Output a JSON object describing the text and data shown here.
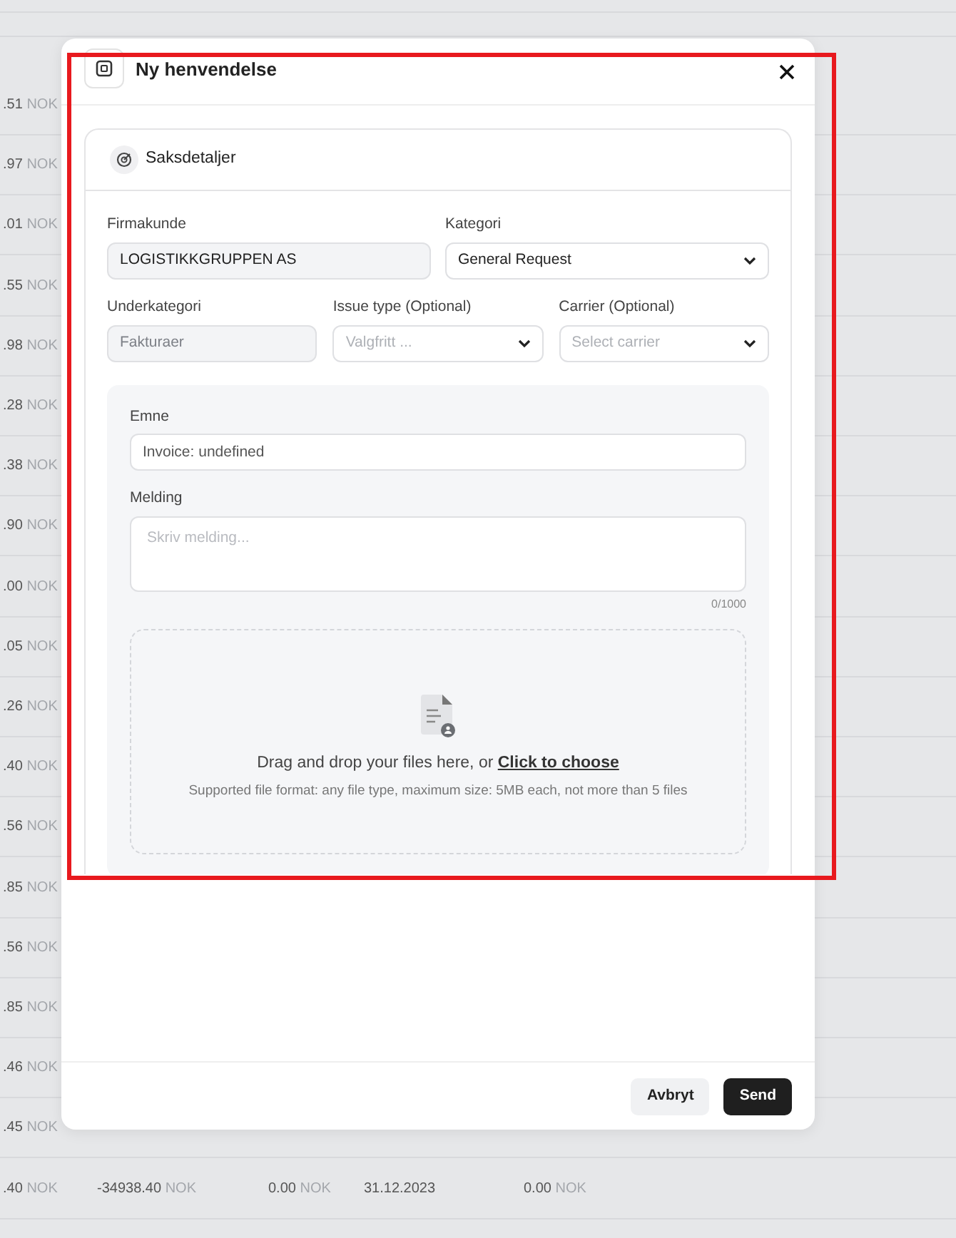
{
  "background_table": {
    "rows": [
      {
        "cells": [
          {
            "amount": ".51",
            "currency": "NOK"
          }
        ]
      },
      {
        "cells": [
          {
            "amount": ".97",
            "currency": "NOK"
          }
        ]
      },
      {
        "cells": [
          {
            "amount": ".01",
            "currency": "NOK"
          }
        ]
      },
      {
        "cells": [
          {
            "amount": ".55",
            "currency": "NOK"
          }
        ]
      },
      {
        "cells": [
          {
            "amount": ".98",
            "currency": "NOK"
          }
        ]
      },
      {
        "cells": [
          {
            "amount": ".28",
            "currency": "NOK"
          }
        ]
      },
      {
        "cells": [
          {
            "amount": ".38",
            "currency": "NOK"
          }
        ]
      },
      {
        "cells": [
          {
            "amount": ".90",
            "currency": "NOK"
          }
        ]
      },
      {
        "cells": [
          {
            "amount": ".00",
            "currency": "NOK"
          }
        ]
      },
      {
        "cells": [
          {
            "amount": ".05",
            "currency": "NOK"
          }
        ]
      },
      {
        "cells": [
          {
            "amount": ".26",
            "currency": "NOK"
          }
        ]
      },
      {
        "cells": [
          {
            "amount": ".40",
            "currency": "NOK"
          }
        ]
      },
      {
        "cells": [
          {
            "amount": ".56",
            "currency": "NOK"
          }
        ]
      },
      {
        "cells": [
          {
            "amount": ".85",
            "currency": "NOK"
          }
        ]
      },
      {
        "cells": [
          {
            "amount": ".56",
            "currency": "NOK"
          }
        ]
      },
      {
        "cells": [
          {
            "amount": ".85",
            "currency": "NOK"
          }
        ]
      },
      {
        "cells": [
          {
            "amount": ".46",
            "currency": "NOK"
          }
        ]
      },
      {
        "cells": [
          {
            "amount": ".45",
            "currency": "NOK"
          }
        ]
      },
      {
        "cells": [
          {
            "amount": ".40",
            "currency": "NOK"
          },
          {
            "amount": "-34938.40",
            "currency": "NOK"
          },
          {
            "amount": "0.00",
            "currency": "NOK"
          },
          {
            "text": "31.12.2023"
          },
          {
            "amount": "0.00",
            "currency": "NOK"
          }
        ]
      }
    ]
  },
  "modal": {
    "title": "Ny henvendelse",
    "section": {
      "title": "Saksdetaljer",
      "fields": [
        {
          "kind": "text",
          "label": "Firmakunde",
          "value": "LOGISTIKKGRUPPEN AS",
          "disabled": true
        },
        {
          "kind": "select",
          "label": "Kategori",
          "value": "General Request"
        },
        {
          "kind": "text",
          "label": "Underkategori",
          "value": "Fakturaer",
          "disabled": true
        },
        {
          "kind": "select",
          "label": "Issue type (Optional)",
          "placeholder": "Valgfritt ..."
        },
        {
          "kind": "select",
          "label": "Carrier (Optional)",
          "placeholder": "Select carrier"
        }
      ],
      "subject": {
        "label": "Emne",
        "value": "Invoice: undefined"
      },
      "message": {
        "label": "Melding",
        "placeholder": "Skriv melding...",
        "counter": "0/1000"
      },
      "dropzone": {
        "text": "Drag and drop your files here, or",
        "link": "Click to choose",
        "hint": "Supported file format: any file type, maximum size: 5MB each, not more than 5 files"
      }
    },
    "buttons": [
      {
        "label": "Avbryt",
        "kind": "secondary"
      },
      {
        "label": "Send",
        "kind": "primary"
      }
    ]
  }
}
